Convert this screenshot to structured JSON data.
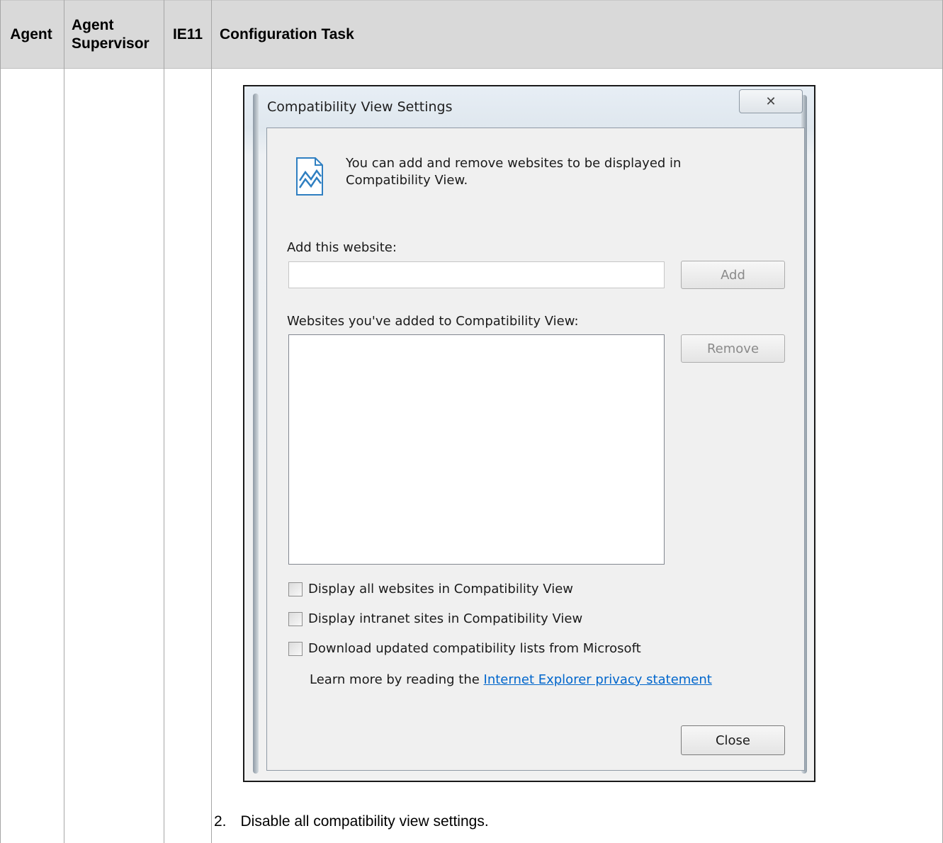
{
  "table": {
    "headers": {
      "agent": "Agent",
      "agent_supervisor_line1": "Agent",
      "agent_supervisor_line2": "Supervisor",
      "ie11": "IE11",
      "configuration_task": "Configuration Task"
    }
  },
  "dialog": {
    "title": "Compatibility View Settings",
    "close_glyph": "✕",
    "intro_line1": "You can add and remove websites to be displayed in",
    "intro_line2": "Compatibility View.",
    "add_website_label": "Add this website:",
    "add_website_value": "",
    "add_button": "Add",
    "list_label": "Websites you've added to Compatibility View:",
    "remove_button": "Remove",
    "checkbox_all": "Display all websites in Compatibility View",
    "checkbox_intranet": "Display intranet sites in Compatibility View",
    "checkbox_download": "Download updated compatibility lists from Microsoft",
    "learn_more_prefix": "Learn more by reading the ",
    "privacy_link": "Internet Explorer privacy statement",
    "close_button": "Close",
    "icon": "compatibility-view-icon"
  },
  "step": {
    "number": "2.",
    "text": "Disable all compatibility view settings."
  }
}
